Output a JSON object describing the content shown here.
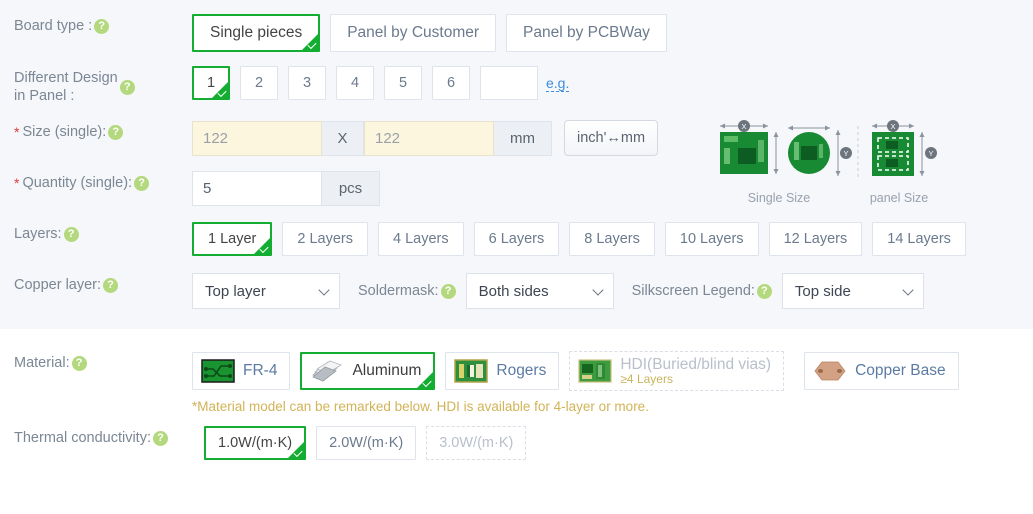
{
  "colors": {
    "selected_green": "#13ad31",
    "section_bg": "#f5f7fa",
    "label": "#7b8794",
    "link_blue": "#3c8dde",
    "note_gold": "#d2b357",
    "required_red": "#e03a3a",
    "help_green": "#b3d87d",
    "size_input_bg": "#fdf6de"
  },
  "help_glyph": "?",
  "rows": {
    "board_type": {
      "label": "Board type :",
      "help": "help-icon",
      "options": [
        {
          "label": "Single pieces",
          "selected": true
        },
        {
          "label": "Panel by Customer",
          "selected": false
        },
        {
          "label": "Panel by PCBWay",
          "selected": false
        }
      ]
    },
    "different_design": {
      "label": "Different Design\nin Panel :",
      "options": [
        {
          "label": "1",
          "selected": true
        },
        {
          "label": "2",
          "selected": false
        },
        {
          "label": "3",
          "selected": false
        },
        {
          "label": "4",
          "selected": false
        },
        {
          "label": "5",
          "selected": false
        },
        {
          "label": "6",
          "selected": false
        }
      ],
      "custom_value": "",
      "custom_placeholder": "",
      "eg_link": "e.g."
    },
    "size": {
      "label": "Size (single):",
      "required": "*",
      "width_value": "122",
      "separator": "X",
      "height_value": "122",
      "unit": "mm",
      "convert_button": "inch'↔mm"
    },
    "quantity": {
      "label": "Quantity (single):",
      "required": "*",
      "value": "5",
      "unit": "pcs"
    },
    "layers": {
      "label": "Layers:",
      "options": [
        {
          "label": "1 Layer",
          "selected": true
        },
        {
          "label": "2 Layers",
          "selected": false
        },
        {
          "label": "4 Layers",
          "selected": false
        },
        {
          "label": "6 Layers",
          "selected": false
        },
        {
          "label": "8 Layers",
          "selected": false
        },
        {
          "label": "10 Layers",
          "selected": false
        },
        {
          "label": "12 Layers",
          "selected": false
        },
        {
          "label": "14 Layers",
          "selected": false
        }
      ]
    },
    "copper_layer": {
      "label": "Copper layer:",
      "value": "Top layer"
    },
    "soldermask": {
      "label": "Soldermask:",
      "value": "Both sides"
    },
    "silkscreen": {
      "label": "Silkscreen Legend:",
      "value": "Top side"
    },
    "material": {
      "label": "Material:",
      "options": [
        {
          "label": "FR-4",
          "icon": "fr4-board-icon",
          "selected": false,
          "disabled": false
        },
        {
          "label": "Aluminum",
          "icon": "aluminum-sheets-icon",
          "selected": true,
          "disabled": false
        },
        {
          "label": "Rogers",
          "icon": "rogers-board-icon",
          "selected": false,
          "disabled": false
        },
        {
          "label": "HDI(Buried/blind vias)",
          "sub": "≥4 Layers",
          "icon": "hdi-board-icon",
          "selected": false,
          "disabled": true
        },
        {
          "label": "Copper Base",
          "icon": "copper-hexagon-icon",
          "selected": false,
          "disabled": false
        }
      ],
      "note": "*Material model can be remarked below. HDI is available for 4-layer or more."
    },
    "thermal": {
      "label": "Thermal conductivity:",
      "options": [
        {
          "label": "1.0W/(m·K)",
          "selected": true,
          "disabled": false
        },
        {
          "label": "2.0W/(m·K)",
          "selected": false,
          "disabled": false
        },
        {
          "label": "3.0W/(m·K)",
          "selected": false,
          "disabled": true
        }
      ]
    }
  },
  "size_diagram": {
    "caption_single": "Single Size",
    "caption_panel": "panel Size",
    "axis_x": "X",
    "axis_y": "Y"
  }
}
